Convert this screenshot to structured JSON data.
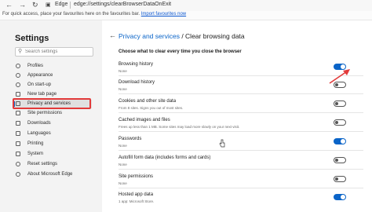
{
  "browser": {
    "edge_label": "Edge",
    "url": "edge://settings/clearBrowserDataOnExit",
    "nav_icons": [
      "back-arrow-icon",
      "forward-arrow-icon",
      "refresh-icon",
      "lock-icon"
    ]
  },
  "favbar": {
    "text": "For quick access, place your favourites here on the favourites bar.",
    "link": "Import favourites now"
  },
  "sidebar": {
    "title": "Settings",
    "search_placeholder": "Search settings",
    "items": [
      {
        "label": "Profiles",
        "icon": "profile-icon"
      },
      {
        "label": "Appearance",
        "icon": "appearance-icon"
      },
      {
        "label": "On start-up",
        "icon": "power-icon"
      },
      {
        "label": "New tab page",
        "icon": "new-tab-icon"
      },
      {
        "label": "Privacy and services",
        "icon": "lock-icon",
        "active": true
      },
      {
        "label": "Site permissions",
        "icon": "permissions-icon"
      },
      {
        "label": "Downloads",
        "icon": "download-icon"
      },
      {
        "label": "Languages",
        "icon": "languages-icon"
      },
      {
        "label": "Printing",
        "icon": "printer-icon"
      },
      {
        "label": "System",
        "icon": "system-icon"
      },
      {
        "label": "Reset settings",
        "icon": "reset-icon"
      },
      {
        "label": "About Microsoft Edge",
        "icon": "edge-icon"
      }
    ]
  },
  "main": {
    "breadcrumb": "Privacy and services",
    "title_sep": " / ",
    "title": "Clear browsing data",
    "subheading": "Choose what to clear every time you close the browser",
    "rows": [
      {
        "title": "Browsing history",
        "desc": "None",
        "on": true
      },
      {
        "title": "Download history",
        "desc": "None",
        "on": false
      },
      {
        "title": "Cookies and other site data",
        "desc": "From 8 sites. Signs you out of most sites.",
        "on": false
      },
      {
        "title": "Cached images and files",
        "desc": "Frees up less than 1 MB. Some sites may load more slowly on your next visit.",
        "on": false
      },
      {
        "title": "Passwords",
        "desc": "None",
        "on": true
      },
      {
        "title": "Autofill form data (includes forms and cards)",
        "desc": "None",
        "on": false
      },
      {
        "title": "Site permissions",
        "desc": "None",
        "on": false
      },
      {
        "title": "Hosted app data",
        "desc": "1 app: Microsoft Store.",
        "on": true
      }
    ]
  },
  "colors": {
    "accent": "#0a64c8",
    "highlight": "#e23a3a"
  }
}
